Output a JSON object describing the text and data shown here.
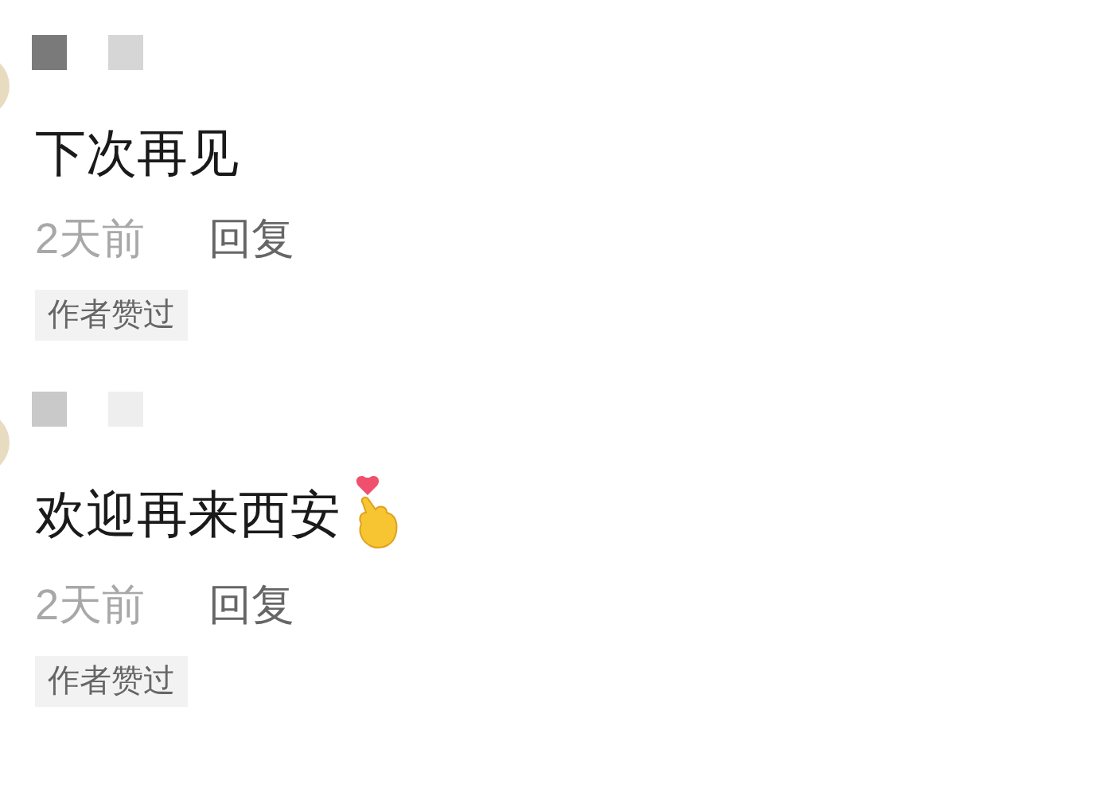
{
  "comments": [
    {
      "text": "下次再见",
      "emoji": false,
      "time": "2天前",
      "reply": "回复",
      "tag": "作者赞过"
    },
    {
      "text": "欢迎再来西安",
      "emoji": true,
      "time": "2天前",
      "reply": "回复",
      "tag": "作者赞过"
    }
  ]
}
